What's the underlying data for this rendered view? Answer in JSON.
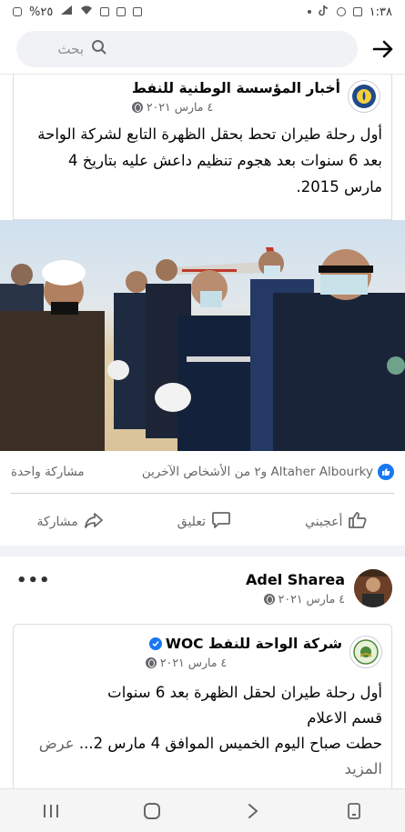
{
  "status_bar": {
    "time": "١:٣٨",
    "battery": "%٢٥"
  },
  "search": {
    "placeholder": "بحث"
  },
  "post1": {
    "page_name": "أخبار المؤسسة الوطنية للنفط",
    "date": "٤ مارس ٢٠٢١",
    "text": "أول رحلة طيران تحط بحقل الظهرة التابع لشركة الواحة بعد 6 سنوات بعد هجوم تنظيم داعش عليه بتاريخ  4 مارس 2015.",
    "reactions_text": "Altaher Albourky و٢ من الأشخاص الآخرين",
    "shares_text": "مشاركة واحدة",
    "actions": {
      "like": "أعجبني",
      "comment": "تعليق",
      "share": "مشاركة"
    }
  },
  "post2": {
    "user_name": "Adel Sharea",
    "user_date": "٤ مارس ٢٠٢١",
    "shared_page_name": "شركة الواحة للنفط WOC",
    "shared_date": "٤ مارس ٢٠٢١",
    "line1": "أول رحلة طيران لحقل الظهرة بعد 6 سنوات",
    "line2": "قسم الاعلام",
    "line3": "حطت صباح اليوم الخميس الموافق 4 مارس 2...",
    "see_more": "عرض المزيد"
  },
  "colors": {
    "accent": "#1877f2",
    "muted": "#65676b"
  }
}
